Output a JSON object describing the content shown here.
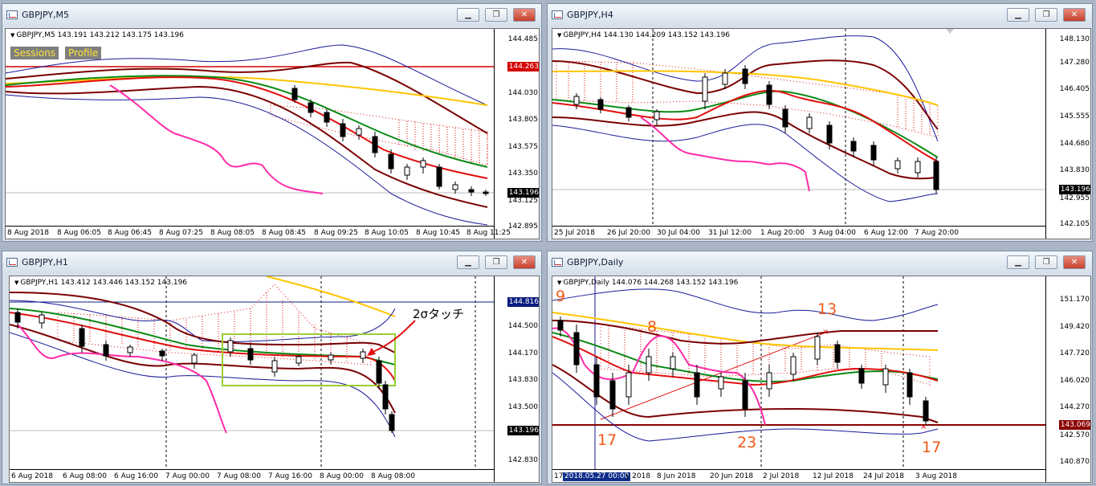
{
  "windows": [
    {
      "title": "GBPJPY,M5",
      "header": "GBPJPY,M5  143.191 143.212 143.175 143.196",
      "buttons": {
        "sessions": "Sessions",
        "profile": "Profile"
      },
      "y_ticks": [
        "144.485",
        "144.030",
        "143.805",
        "143.575",
        "143.350",
        "143.125",
        "142.895"
      ],
      "price_tags": [
        {
          "label": "144.263",
          "color": "#d40000"
        },
        {
          "label": "143.196",
          "color": "#000000"
        }
      ],
      "x_ticks": [
        "8 Aug 2018",
        "8 Aug 06:05",
        "8 Aug 06:45",
        "8 Aug 07:25",
        "8 Aug 08:05",
        "8 Aug 08:45",
        "8 Aug 09:25",
        "8 Aug 10:05",
        "8 Aug 10:45",
        "8 Aug 11:25"
      ]
    },
    {
      "title": "GBPJPY,H4",
      "header": "GBPJPY,H4  144.130 144.209 143.152 143.196",
      "y_ticks": [
        "148.130",
        "147.280",
        "146.405",
        "145.555",
        "144.680",
        "143.830",
        "142.955",
        "142.105"
      ],
      "price_tags": [
        {
          "label": "143.196",
          "color": "#000000"
        }
      ],
      "x_ticks": [
        "25 Jul 2018",
        "26 Jul 20:00",
        "30 Jul 04:00",
        "31 Jul 12:00",
        "1 Aug 20:00",
        "3 Aug 04:00",
        "6 Aug 12:00",
        "7 Aug 20:00"
      ]
    },
    {
      "title": "GBPJPY,H1",
      "header": "GBPJPY,H1  143.412 143.446 143.152 143.196",
      "y_ticks": [
        "144.500",
        "144.170",
        "143.830",
        "143.500",
        "142.830"
      ],
      "price_tags": [
        {
          "label": "144.816",
          "color": "#0a1c80"
        },
        {
          "label": "143.196",
          "color": "#000000"
        }
      ],
      "note": "2σタッチ",
      "x_ticks": [
        "6 Aug 2018",
        "6 Aug 08:00",
        "6 Aug 16:00",
        "7 Aug 00:00",
        "7 Aug 08:00",
        "7 Aug 16:00",
        "8 Aug 00:00",
        "8 Aug 08:00"
      ]
    },
    {
      "title": "GBPJPY,Daily",
      "header": "GBPJPY,Daily  144.076 144.268 143.152 143.196",
      "y_ticks": [
        "151.170",
        "149.420",
        "147.720",
        "146.020",
        "144.270",
        "142.570",
        "140.870"
      ],
      "price_tags": [
        {
          "label": "143.069",
          "color": "#8b0000"
        }
      ],
      "annotations": [
        "9",
        "8",
        "13",
        "17",
        "23",
        "17"
      ],
      "date_tag": "2018.05.27 00:00",
      "x_ticks": [
        "17",
        "y 2018",
        "8 Jun 2018",
        "20 Jun 2018",
        "2 Jul 2018",
        "12 Jul 2018",
        "24 Jul 2018",
        "3 Aug 2018"
      ]
    }
  ],
  "window_controls": {
    "minimize": "▁",
    "restore": "❐",
    "close": "✕"
  }
}
